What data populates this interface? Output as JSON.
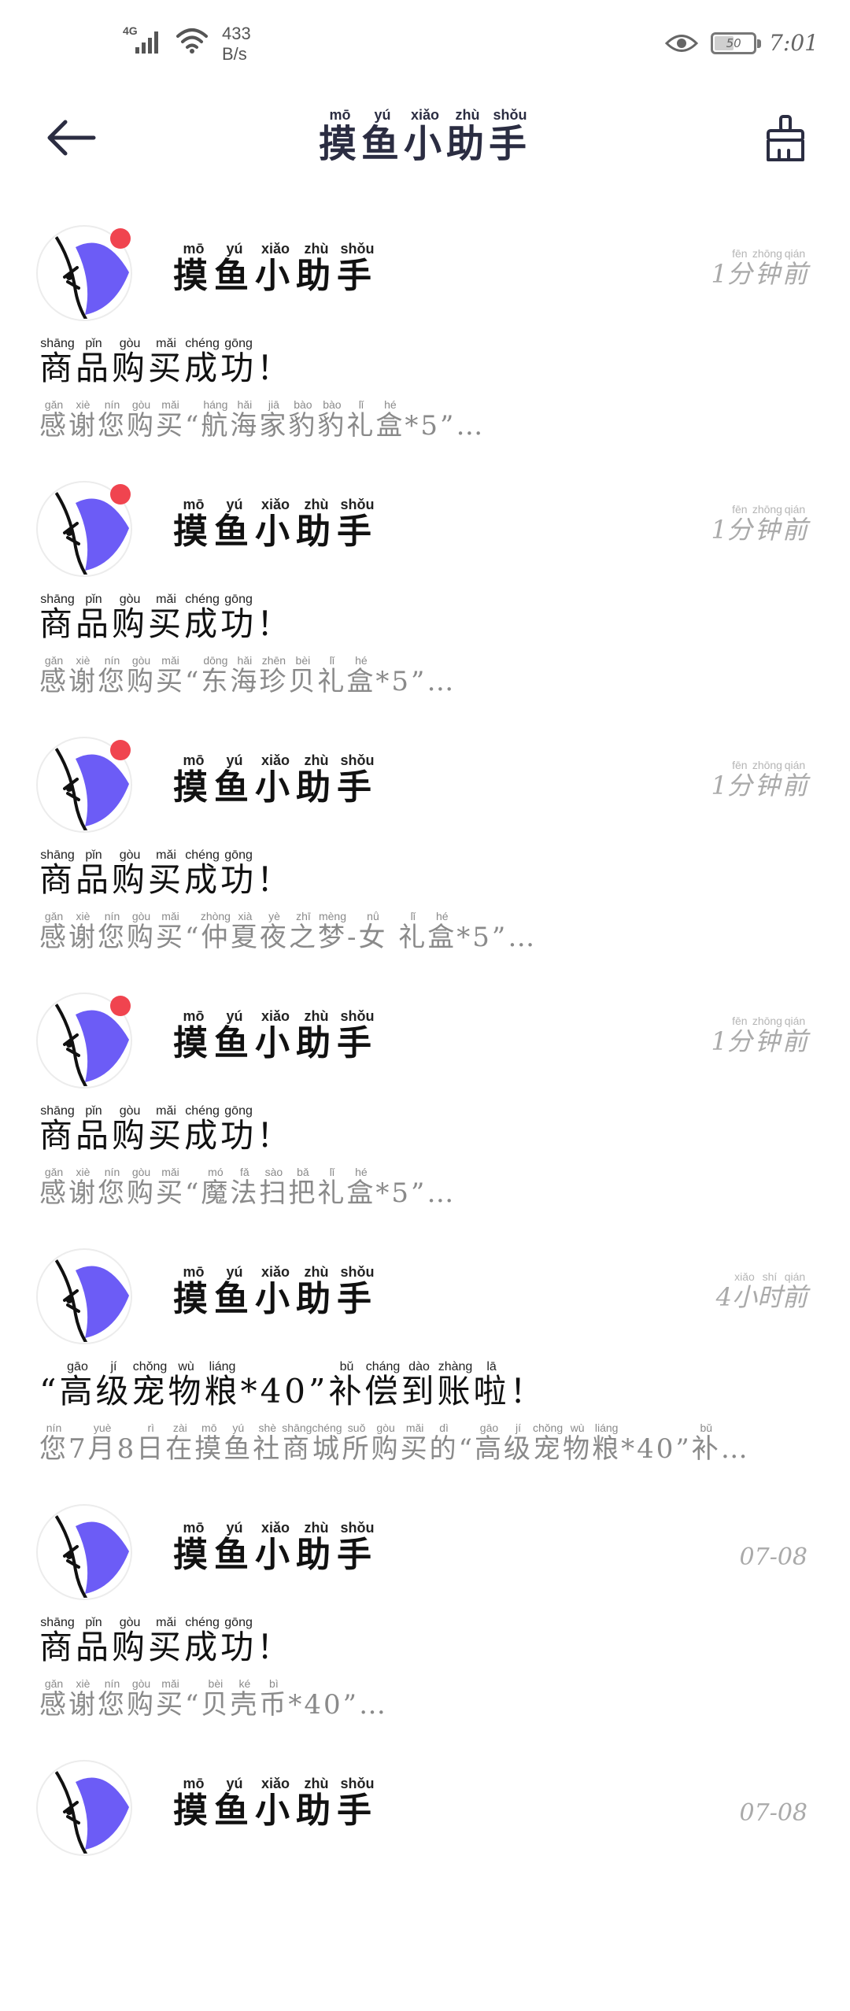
{
  "status_bar": {
    "network_type": "4G",
    "net_speed_value": "433",
    "net_speed_unit": "B/s",
    "battery": "50",
    "time": "7:01",
    "icons": [
      "signal-icon",
      "wifi-icon",
      "eye-icon",
      "battery-icon"
    ]
  },
  "header": {
    "title": [
      {
        "char": "摸",
        "py": "mō"
      },
      {
        "char": "鱼",
        "py": "yú"
      },
      {
        "char": "小",
        "py": "xiǎo"
      },
      {
        "char": "助",
        "py": "zhù"
      },
      {
        "char": "手",
        "py": "shǒu"
      }
    ],
    "back_icon": "arrow-left-icon",
    "clean_icon": "broom-icon"
  },
  "messages": [
    {
      "unread": true,
      "sender": [
        {
          "char": "摸",
          "py": "mō"
        },
        {
          "char": "鱼",
          "py": "yú"
        },
        {
          "char": "小",
          "py": "xiǎo"
        },
        {
          "char": "助",
          "py": "zhù"
        },
        {
          "char": "手",
          "py": "shǒu"
        }
      ],
      "time": [
        {
          "char": "1",
          "py": ""
        },
        {
          "char": "分",
          "py": "fēn"
        },
        {
          "char": "钟",
          "py": "zhōng"
        },
        {
          "char": "前",
          "py": "qián"
        }
      ],
      "title": [
        {
          "char": "商",
          "py": "shāng"
        },
        {
          "char": "品",
          "py": "pǐn"
        },
        {
          "char": "购",
          "py": "gòu"
        },
        {
          "char": "买",
          "py": "mǎi"
        },
        {
          "char": "成",
          "py": "chéng"
        },
        {
          "char": "功",
          "py": "gōng"
        },
        {
          "char": "！",
          "py": ""
        }
      ],
      "body": [
        {
          "char": "感",
          "py": "gǎn"
        },
        {
          "char": "谢",
          "py": "xiè"
        },
        {
          "char": "您",
          "py": "nín"
        },
        {
          "char": "购",
          "py": "gòu"
        },
        {
          "char": "买",
          "py": "mǎi"
        },
        {
          "char": "“",
          "py": ""
        },
        {
          "char": "航",
          "py": "háng"
        },
        {
          "char": "海",
          "py": "hǎi"
        },
        {
          "char": "家",
          "py": "jiā"
        },
        {
          "char": "豹",
          "py": "bào"
        },
        {
          "char": "豹",
          "py": "bào"
        },
        {
          "char": "礼",
          "py": "lǐ"
        },
        {
          "char": "盒",
          "py": "hé"
        },
        {
          "char": "*5”…",
          "py": ""
        }
      ]
    },
    {
      "unread": true,
      "sender": [
        {
          "char": "摸",
          "py": "mō"
        },
        {
          "char": "鱼",
          "py": "yú"
        },
        {
          "char": "小",
          "py": "xiǎo"
        },
        {
          "char": "助",
          "py": "zhù"
        },
        {
          "char": "手",
          "py": "shǒu"
        }
      ],
      "time": [
        {
          "char": "1",
          "py": ""
        },
        {
          "char": "分",
          "py": "fēn"
        },
        {
          "char": "钟",
          "py": "zhōng"
        },
        {
          "char": "前",
          "py": "qián"
        }
      ],
      "title": [
        {
          "char": "商",
          "py": "shāng"
        },
        {
          "char": "品",
          "py": "pǐn"
        },
        {
          "char": "购",
          "py": "gòu"
        },
        {
          "char": "买",
          "py": "mǎi"
        },
        {
          "char": "成",
          "py": "chéng"
        },
        {
          "char": "功",
          "py": "gōng"
        },
        {
          "char": "！",
          "py": ""
        }
      ],
      "body": [
        {
          "char": "感",
          "py": "gǎn"
        },
        {
          "char": "谢",
          "py": "xiè"
        },
        {
          "char": "您",
          "py": "nín"
        },
        {
          "char": "购",
          "py": "gòu"
        },
        {
          "char": "买",
          "py": "mǎi"
        },
        {
          "char": "“",
          "py": ""
        },
        {
          "char": "东",
          "py": "dōng"
        },
        {
          "char": "海",
          "py": "hǎi"
        },
        {
          "char": "珍",
          "py": "zhēn"
        },
        {
          "char": "贝",
          "py": "bèi"
        },
        {
          "char": "礼",
          "py": "lǐ"
        },
        {
          "char": "盒",
          "py": "hé"
        },
        {
          "char": "*5”…",
          "py": ""
        }
      ]
    },
    {
      "unread": true,
      "sender": [
        {
          "char": "摸",
          "py": "mō"
        },
        {
          "char": "鱼",
          "py": "yú"
        },
        {
          "char": "小",
          "py": "xiǎo"
        },
        {
          "char": "助",
          "py": "zhù"
        },
        {
          "char": "手",
          "py": "shǒu"
        }
      ],
      "time": [
        {
          "char": "1",
          "py": ""
        },
        {
          "char": "分",
          "py": "fēn"
        },
        {
          "char": "钟",
          "py": "zhōng"
        },
        {
          "char": "前",
          "py": "qián"
        }
      ],
      "title": [
        {
          "char": "商",
          "py": "shāng"
        },
        {
          "char": "品",
          "py": "pǐn"
        },
        {
          "char": "购",
          "py": "gòu"
        },
        {
          "char": "买",
          "py": "mǎi"
        },
        {
          "char": "成",
          "py": "chéng"
        },
        {
          "char": "功",
          "py": "gōng"
        },
        {
          "char": "！",
          "py": ""
        }
      ],
      "body": [
        {
          "char": "感",
          "py": "gǎn"
        },
        {
          "char": "谢",
          "py": "xiè"
        },
        {
          "char": "您",
          "py": "nín"
        },
        {
          "char": "购",
          "py": "gòu"
        },
        {
          "char": "买",
          "py": "mǎi"
        },
        {
          "char": "“",
          "py": ""
        },
        {
          "char": "仲",
          "py": "zhòng"
        },
        {
          "char": "夏",
          "py": "xià"
        },
        {
          "char": "夜",
          "py": "yè"
        },
        {
          "char": "之",
          "py": "zhī"
        },
        {
          "char": "梦",
          "py": "mèng"
        },
        {
          "char": "-",
          "py": ""
        },
        {
          "char": "女",
          "py": "nǚ"
        },
        {
          "char": " ",
          "py": ""
        },
        {
          "char": "礼",
          "py": "lǐ"
        },
        {
          "char": "盒",
          "py": "hé"
        },
        {
          "char": "*5”…",
          "py": ""
        }
      ]
    },
    {
      "unread": true,
      "sender": [
        {
          "char": "摸",
          "py": "mō"
        },
        {
          "char": "鱼",
          "py": "yú"
        },
        {
          "char": "小",
          "py": "xiǎo"
        },
        {
          "char": "助",
          "py": "zhù"
        },
        {
          "char": "手",
          "py": "shǒu"
        }
      ],
      "time": [
        {
          "char": "1",
          "py": ""
        },
        {
          "char": "分",
          "py": "fēn"
        },
        {
          "char": "钟",
          "py": "zhōng"
        },
        {
          "char": "前",
          "py": "qián"
        }
      ],
      "title": [
        {
          "char": "商",
          "py": "shāng"
        },
        {
          "char": "品",
          "py": "pǐn"
        },
        {
          "char": "购",
          "py": "gòu"
        },
        {
          "char": "买",
          "py": "mǎi"
        },
        {
          "char": "成",
          "py": "chéng"
        },
        {
          "char": "功",
          "py": "gōng"
        },
        {
          "char": "！",
          "py": ""
        }
      ],
      "body": [
        {
          "char": "感",
          "py": "gǎn"
        },
        {
          "char": "谢",
          "py": "xiè"
        },
        {
          "char": "您",
          "py": "nín"
        },
        {
          "char": "购",
          "py": "gòu"
        },
        {
          "char": "买",
          "py": "mǎi"
        },
        {
          "char": "“",
          "py": ""
        },
        {
          "char": "魔",
          "py": "mó"
        },
        {
          "char": "法",
          "py": "fǎ"
        },
        {
          "char": "扫",
          "py": "sào"
        },
        {
          "char": "把",
          "py": "bǎ"
        },
        {
          "char": "礼",
          "py": "lǐ"
        },
        {
          "char": "盒",
          "py": "hé"
        },
        {
          "char": "*5”…",
          "py": ""
        }
      ]
    },
    {
      "unread": false,
      "sender": [
        {
          "char": "摸",
          "py": "mō"
        },
        {
          "char": "鱼",
          "py": "yú"
        },
        {
          "char": "小",
          "py": "xiǎo"
        },
        {
          "char": "助",
          "py": "zhù"
        },
        {
          "char": "手",
          "py": "shǒu"
        }
      ],
      "time": [
        {
          "char": "4",
          "py": ""
        },
        {
          "char": "小",
          "py": "xiǎo"
        },
        {
          "char": "时",
          "py": "shí"
        },
        {
          "char": "前",
          "py": "qián"
        }
      ],
      "title": [
        {
          "char": "“",
          "py": ""
        },
        {
          "char": "高",
          "py": "gāo"
        },
        {
          "char": "级",
          "py": "jí"
        },
        {
          "char": "宠",
          "py": "chǒng"
        },
        {
          "char": "物",
          "py": "wù"
        },
        {
          "char": "粮",
          "py": "liáng"
        },
        {
          "char": "*40”",
          "py": ""
        },
        {
          "char": "补",
          "py": "bǔ"
        },
        {
          "char": "偿",
          "py": "cháng"
        },
        {
          "char": "到",
          "py": "dào"
        },
        {
          "char": "账",
          "py": "zhàng"
        },
        {
          "char": "啦",
          "py": "lā"
        },
        {
          "char": "！",
          "py": ""
        }
      ],
      "body": [
        {
          "char": "您",
          "py": "nín"
        },
        {
          "char": "7",
          "py": ""
        },
        {
          "char": "月",
          "py": "yuè"
        },
        {
          "char": "8",
          "py": ""
        },
        {
          "char": "日",
          "py": "rì"
        },
        {
          "char": "在",
          "py": "zài"
        },
        {
          "char": "摸",
          "py": "mō"
        },
        {
          "char": "鱼",
          "py": "yú"
        },
        {
          "char": "社",
          "py": "shè"
        },
        {
          "char": "商",
          "py": "shāng"
        },
        {
          "char": "城",
          "py": "chéng"
        },
        {
          "char": "所",
          "py": "suǒ"
        },
        {
          "char": "购",
          "py": "gòu"
        },
        {
          "char": "买",
          "py": "mǎi"
        },
        {
          "char": "的",
          "py": "dì"
        },
        {
          "char": "“",
          "py": ""
        },
        {
          "char": "高",
          "py": "gāo"
        },
        {
          "char": "级",
          "py": "jí"
        },
        {
          "char": "宠",
          "py": "chǒng"
        },
        {
          "char": "物",
          "py": "wù"
        },
        {
          "char": "粮",
          "py": "liáng"
        },
        {
          "char": "*40”",
          "py": ""
        },
        {
          "char": "补",
          "py": "bǔ"
        },
        {
          "char": "…",
          "py": ""
        }
      ]
    },
    {
      "unread": false,
      "sender": [
        {
          "char": "摸",
          "py": "mō"
        },
        {
          "char": "鱼",
          "py": "yú"
        },
        {
          "char": "小",
          "py": "xiǎo"
        },
        {
          "char": "助",
          "py": "zhù"
        },
        {
          "char": "手",
          "py": "shǒu"
        }
      ],
      "time_plain": "07-08",
      "title": [
        {
          "char": "商",
          "py": "shāng"
        },
        {
          "char": "品",
          "py": "pǐn"
        },
        {
          "char": "购",
          "py": "gòu"
        },
        {
          "char": "买",
          "py": "mǎi"
        },
        {
          "char": "成",
          "py": "chéng"
        },
        {
          "char": "功",
          "py": "gōng"
        },
        {
          "char": "！",
          "py": ""
        }
      ],
      "body": [
        {
          "char": "感",
          "py": "gǎn"
        },
        {
          "char": "谢",
          "py": "xiè"
        },
        {
          "char": "您",
          "py": "nín"
        },
        {
          "char": "购",
          "py": "gòu"
        },
        {
          "char": "买",
          "py": "mǎi"
        },
        {
          "char": "“",
          "py": ""
        },
        {
          "char": "贝",
          "py": "bèi"
        },
        {
          "char": "壳",
          "py": "ké"
        },
        {
          "char": "币",
          "py": "bì"
        },
        {
          "char": "*40”…",
          "py": ""
        }
      ]
    },
    {
      "unread": false,
      "sender": [
        {
          "char": "摸",
          "py": "mō"
        },
        {
          "char": "鱼",
          "py": "yú"
        },
        {
          "char": "小",
          "py": "xiǎo"
        },
        {
          "char": "助",
          "py": "zhù"
        },
        {
          "char": "手",
          "py": "shǒu"
        }
      ],
      "time_plain": "07-08",
      "title": [],
      "body": []
    }
  ],
  "colors": {
    "accent_purple": "#6c5cf6",
    "unread_dot": "#f0444f",
    "title_navy": "#2b2d42",
    "muted_text": "#8a8a8a",
    "time_text": "#aaaaaa"
  }
}
